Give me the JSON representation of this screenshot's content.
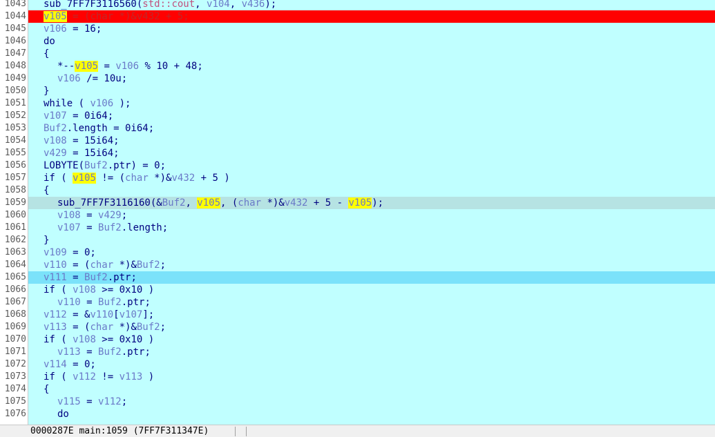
{
  "lines": [
    {
      "num": "1043",
      "indent": 0,
      "hl": "",
      "tokens": [
        [
          "f",
          "sub_7FF7F3116560"
        ],
        [
          "p",
          "("
        ],
        [
          "pink",
          "std::cout"
        ],
        [
          "p",
          ", "
        ],
        [
          "v",
          "v104"
        ],
        [
          "p",
          ", "
        ],
        [
          "v",
          "v436"
        ],
        [
          "p",
          ");"
        ]
      ]
    },
    {
      "num": "1044",
      "indent": 0,
      "hl": "red",
      "tokens": [
        [
          "hv",
          "v105"
        ],
        [
          "p",
          " = ("
        ],
        [
          "s",
          "char"
        ],
        [
          "p",
          " *)&"
        ],
        [
          "v",
          "v432"
        ],
        [
          "p",
          " + 5;"
        ]
      ]
    },
    {
      "num": "1045",
      "indent": 0,
      "hl": "",
      "tokens": [
        [
          "v",
          "v106"
        ],
        [
          "p",
          " = 16;"
        ]
      ]
    },
    {
      "num": "1046",
      "indent": 0,
      "hl": "",
      "tokens": [
        [
          "k",
          "do"
        ]
      ]
    },
    {
      "num": "1047",
      "indent": 0,
      "hl": "",
      "tokens": [
        [
          "p",
          "{"
        ]
      ]
    },
    {
      "num": "1048",
      "indent": 1,
      "hl": "",
      "tokens": [
        [
          "p",
          "*--"
        ],
        [
          "hv",
          "v105"
        ],
        [
          "p",
          " = "
        ],
        [
          "v",
          "v106"
        ],
        [
          "p",
          " % 10 + 48;"
        ]
      ]
    },
    {
      "num": "1049",
      "indent": 1,
      "hl": "",
      "tokens": [
        [
          "v",
          "v106"
        ],
        [
          "p",
          " /= 10u;"
        ]
      ]
    },
    {
      "num": "1050",
      "indent": 0,
      "hl": "",
      "tokens": [
        [
          "p",
          "}"
        ]
      ]
    },
    {
      "num": "1051",
      "indent": 0,
      "hl": "",
      "tokens": [
        [
          "k",
          "while"
        ],
        [
          "p",
          " ( "
        ],
        [
          "v",
          "v106"
        ],
        [
          "p",
          " );"
        ]
      ]
    },
    {
      "num": "1052",
      "indent": 0,
      "hl": "",
      "tokens": [
        [
          "v",
          "v107"
        ],
        [
          "p",
          " = 0i64;"
        ]
      ]
    },
    {
      "num": "1053",
      "indent": 0,
      "hl": "",
      "tokens": [
        [
          "v",
          "Buf2"
        ],
        [
          "p",
          ".length = 0i64;"
        ]
      ]
    },
    {
      "num": "1054",
      "indent": 0,
      "hl": "",
      "tokens": [
        [
          "v",
          "v108"
        ],
        [
          "p",
          " = 15i64;"
        ]
      ]
    },
    {
      "num": "1055",
      "indent": 0,
      "hl": "",
      "tokens": [
        [
          "v",
          "v429"
        ],
        [
          "p",
          " = 15i64;"
        ]
      ]
    },
    {
      "num": "1056",
      "indent": 0,
      "hl": "",
      "tokens": [
        [
          "f",
          "LOBYTE"
        ],
        [
          "p",
          "("
        ],
        [
          "v",
          "Buf2"
        ],
        [
          "p",
          ".ptr) = 0;"
        ]
      ]
    },
    {
      "num": "1057",
      "indent": 0,
      "hl": "",
      "tokens": [
        [
          "k",
          "if"
        ],
        [
          "p",
          " ( "
        ],
        [
          "hv",
          "v105"
        ],
        [
          "p",
          " != ("
        ],
        [
          "s",
          "char"
        ],
        [
          "p",
          " *)&"
        ],
        [
          "v",
          "v432"
        ],
        [
          "p",
          " + 5 )"
        ]
      ]
    },
    {
      "num": "1058",
      "indent": 0,
      "hl": "",
      "tokens": [
        [
          "p",
          "{"
        ]
      ]
    },
    {
      "num": "1059",
      "indent": 1,
      "hl": "gray",
      "tokens": [
        [
          "f",
          "sub_7FF7F3116160"
        ],
        [
          "p",
          "(&"
        ],
        [
          "v",
          "Buf2"
        ],
        [
          "p",
          ", "
        ],
        [
          "hv",
          "v105"
        ],
        [
          "p",
          ", ("
        ],
        [
          "s",
          "char"
        ],
        [
          "p",
          " *)&"
        ],
        [
          "v",
          "v432"
        ],
        [
          "p",
          " + 5 - "
        ],
        [
          "hv",
          "v105"
        ],
        [
          "p",
          ");"
        ]
      ]
    },
    {
      "num": "1060",
      "indent": 1,
      "hl": "",
      "tokens": [
        [
          "v",
          "v108"
        ],
        [
          "p",
          " = "
        ],
        [
          "v",
          "v429"
        ],
        [
          "p",
          ";"
        ]
      ]
    },
    {
      "num": "1061",
      "indent": 1,
      "hl": "",
      "tokens": [
        [
          "v",
          "v107"
        ],
        [
          "p",
          " = "
        ],
        [
          "v",
          "Buf2"
        ],
        [
          "p",
          ".length;"
        ]
      ]
    },
    {
      "num": "1062",
      "indent": 0,
      "hl": "",
      "tokens": [
        [
          "p",
          "}"
        ]
      ]
    },
    {
      "num": "1063",
      "indent": 0,
      "hl": "",
      "tokens": [
        [
          "v",
          "v109"
        ],
        [
          "p",
          " = 0;"
        ]
      ]
    },
    {
      "num": "1064",
      "indent": 0,
      "hl": "",
      "tokens": [
        [
          "v",
          "v110"
        ],
        [
          "p",
          " = ("
        ],
        [
          "s",
          "char"
        ],
        [
          "p",
          " *)&"
        ],
        [
          "v",
          "Buf2"
        ],
        [
          "p",
          ";"
        ]
      ]
    },
    {
      "num": "1065",
      "indent": 0,
      "hl": "blue",
      "tokens": [
        [
          "v",
          "v111"
        ],
        [
          "p",
          " = "
        ],
        [
          "v",
          "Buf2"
        ],
        [
          "p",
          ".ptr;"
        ]
      ]
    },
    {
      "num": "1066",
      "indent": 0,
      "hl": "",
      "tokens": [
        [
          "k",
          "if"
        ],
        [
          "p",
          " ( "
        ],
        [
          "v",
          "v108"
        ],
        [
          "p",
          " >= 0x10 )"
        ]
      ]
    },
    {
      "num": "1067",
      "indent": 1,
      "hl": "",
      "tokens": [
        [
          "v",
          "v110"
        ],
        [
          "p",
          " = "
        ],
        [
          "v",
          "Buf2"
        ],
        [
          "p",
          ".ptr;"
        ]
      ]
    },
    {
      "num": "1068",
      "indent": 0,
      "hl": "",
      "tokens": [
        [
          "v",
          "v112"
        ],
        [
          "p",
          " = &"
        ],
        [
          "v",
          "v110"
        ],
        [
          "p",
          "["
        ],
        [
          "v",
          "v107"
        ],
        [
          "p",
          "];"
        ]
      ]
    },
    {
      "num": "1069",
      "indent": 0,
      "hl": "",
      "tokens": [
        [
          "v",
          "v113"
        ],
        [
          "p",
          " = ("
        ],
        [
          "s",
          "char"
        ],
        [
          "p",
          " *)&"
        ],
        [
          "v",
          "Buf2"
        ],
        [
          "p",
          ";"
        ]
      ]
    },
    {
      "num": "1070",
      "indent": 0,
      "hl": "",
      "tokens": [
        [
          "k",
          "if"
        ],
        [
          "p",
          " ( "
        ],
        [
          "v",
          "v108"
        ],
        [
          "p",
          " >= 0x10 )"
        ]
      ]
    },
    {
      "num": "1071",
      "indent": 1,
      "hl": "",
      "tokens": [
        [
          "v",
          "v113"
        ],
        [
          "p",
          " = "
        ],
        [
          "v",
          "Buf2"
        ],
        [
          "p",
          ".ptr;"
        ]
      ]
    },
    {
      "num": "1072",
      "indent": 0,
      "hl": "",
      "tokens": [
        [
          "v",
          "v114"
        ],
        [
          "p",
          " = 0;"
        ]
      ]
    },
    {
      "num": "1073",
      "indent": 0,
      "hl": "",
      "tokens": [
        [
          "k",
          "if"
        ],
        [
          "p",
          " ( "
        ],
        [
          "v",
          "v112"
        ],
        [
          "p",
          " != "
        ],
        [
          "v",
          "v113"
        ],
        [
          "p",
          " )"
        ]
      ]
    },
    {
      "num": "1074",
      "indent": 0,
      "hl": "",
      "tokens": [
        [
          "p",
          "{"
        ]
      ]
    },
    {
      "num": "1075",
      "indent": 1,
      "hl": "",
      "tokens": [
        [
          "v",
          "v115"
        ],
        [
          "p",
          " = "
        ],
        [
          "v",
          "v112"
        ],
        [
          "p",
          ";"
        ]
      ]
    },
    {
      "num": "1076",
      "indent": 1,
      "hl": "",
      "tokens": [
        [
          "k",
          "do"
        ]
      ]
    }
  ],
  "status": {
    "text": "0000287E main:1059 (7FF7F311347E)"
  },
  "colors": {
    "background": "#c0ffff",
    "current_line": "#ff0000",
    "highlight_identifier": "#ffff00",
    "cursor_line": "#b6e3e3",
    "selected_line": "#7be2fa"
  }
}
